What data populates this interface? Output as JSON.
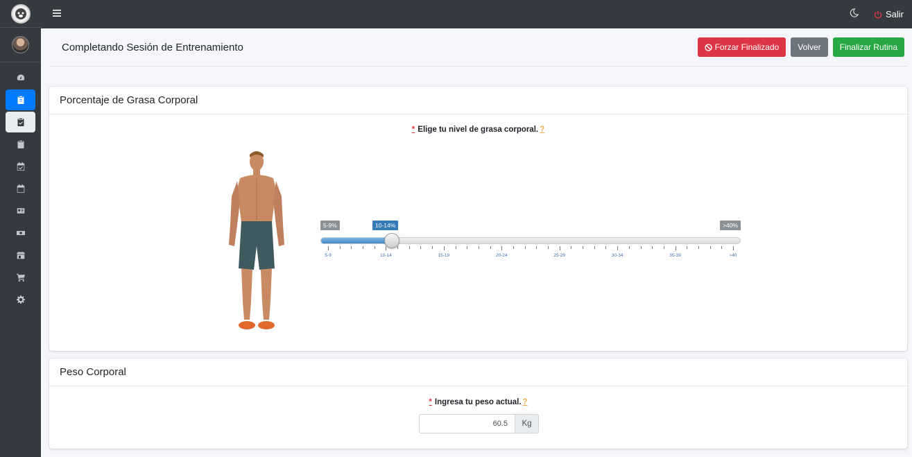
{
  "topbar": {
    "logout_label": "Salir"
  },
  "header": {
    "title": "Completando Sesión de Entrenamiento",
    "force_label": "Forzar Finalizado",
    "back_label": "Volver",
    "finish_label": "Finalizar Rutina"
  },
  "body_fat": {
    "title": "Porcentaje de Grasa Corporal",
    "question": "Elige tu nivel de grasa corporal.",
    "required_mark": "*",
    "help_mark": "?",
    "min_tag": "5-9%",
    "current_tag": "10-14%",
    "max_tag": ">40%",
    "selected_fraction": 0.158,
    "tick_labels": [
      "5-9",
      "10-14",
      "15-19",
      "20-24",
      "25-29",
      "30-34",
      "35-39",
      ">40"
    ]
  },
  "weight": {
    "title": "Peso Corporal",
    "question": "Ingresa tu peso actual.",
    "required_mark": "*",
    "help_mark": "?",
    "value": "60.5",
    "unit": "Kg"
  },
  "colors": {
    "danger": "#dc3545",
    "secondary": "#6c757d",
    "success": "#28a745",
    "primary": "#007bff"
  }
}
